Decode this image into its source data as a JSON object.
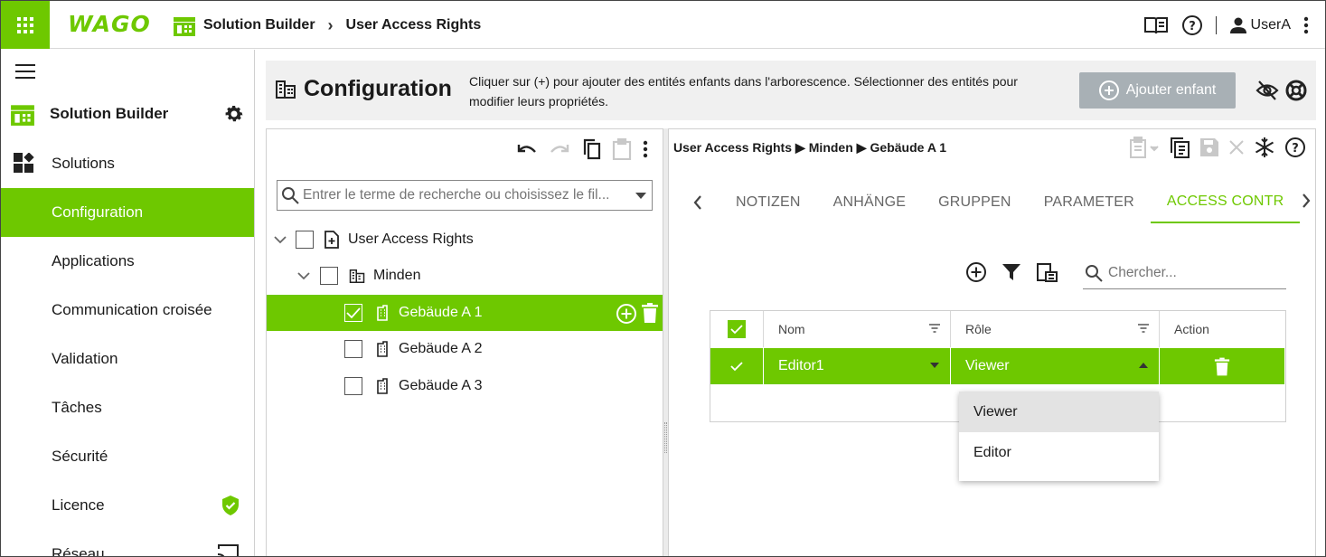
{
  "header": {
    "brand": "WAGO",
    "breadcrumb": [
      "Solution Builder",
      "User Access Rights"
    ],
    "user": "UserA"
  },
  "sidebar": {
    "brand_title": "Solution Builder",
    "items": [
      {
        "label": "Solutions",
        "icon": "dashboard-icon"
      },
      {
        "label": "Configuration",
        "active": true
      },
      {
        "label": "Applications"
      },
      {
        "label": "Communication croisée"
      },
      {
        "label": "Validation"
      },
      {
        "label": "Tâches"
      },
      {
        "label": "Sécurité"
      },
      {
        "label": "Licence",
        "badge": "shield-check-icon"
      },
      {
        "label": "Réseau",
        "icon": "cast-icon"
      }
    ]
  },
  "config": {
    "title": "Configuration",
    "description": "Cliquer sur (+) pour ajouter des entités enfants dans l'arborescence. Sélectionner des entités pour modifier leurs propriétés.",
    "add_child": "Ajouter enfant"
  },
  "tree": {
    "search_placeholder": "Entrer le terme de recherche ou choisissez le fil...",
    "nodes": [
      {
        "label": "User Access Rights",
        "level": 0,
        "expanded": true,
        "checked": false
      },
      {
        "label": "Minden",
        "level": 1,
        "expanded": true,
        "checked": false
      },
      {
        "label": "Gebäude A 1",
        "level": 2,
        "checked": true,
        "selected": true
      },
      {
        "label": "Gebäude A 2",
        "level": 2,
        "checked": false
      },
      {
        "label": "Gebäude A 3",
        "level": 2,
        "checked": false
      }
    ]
  },
  "detail": {
    "path": [
      "User Access Rights",
      "Minden",
      "Gebäude A 1"
    ],
    "path_sep": "▶",
    "tabs": [
      "NOTIZEN",
      "ANHÄNGE",
      "GRUPPEN",
      "PARAMETER",
      "ACCESS CONTR"
    ],
    "active_tab": "ACCESS CONTR",
    "search_placeholder": "Chercher...",
    "table": {
      "columns": [
        "Nom",
        "Rôle",
        "Action"
      ],
      "rows": [
        {
          "name": "Editor1",
          "role": "Viewer",
          "checked": true
        }
      ]
    },
    "role_options": [
      "Viewer",
      "Editor"
    ],
    "highlighted_option": "Viewer"
  },
  "colors": {
    "accent": "#6ec800",
    "disabled_button": "#a8b0b5",
    "header_bg": "#f0f0f0"
  }
}
